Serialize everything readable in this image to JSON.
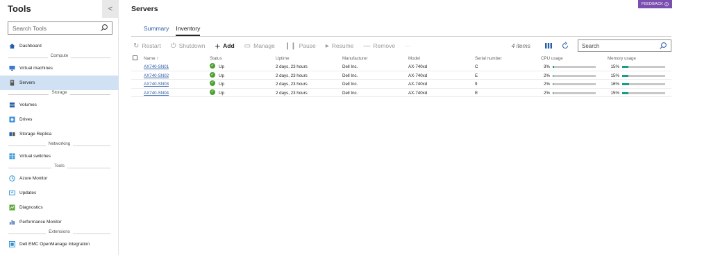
{
  "sidebar": {
    "title": "Tools",
    "collapse_glyph": "<",
    "search_placeholder": "Search Tools",
    "groups": {
      "compute": "Compute",
      "storage": "Storage",
      "networking": "Networking",
      "tools": "Tools",
      "extensions": "Extensions"
    },
    "items": {
      "dashboard": "Dashboard",
      "virtual_machines": "Virtual machines",
      "servers": "Servers",
      "volumes": "Volumes",
      "drives": "Drives",
      "storage_replica": "Storage Replica",
      "virtual_switches": "Virtual switches",
      "azure_monitor": "Azure Monitor",
      "updates": "Updates",
      "diagnostics": "Diagnostics",
      "performance_monitor": "Performance Monitor",
      "dell_emc": "Dell EMC OpenManage Integration"
    },
    "active_item": "Servers"
  },
  "header": {
    "title": "Servers",
    "feedback_label": "FEEDBACK",
    "feedback_icon": "info-icon"
  },
  "tabs": [
    {
      "label": "Summary",
      "active": false
    },
    {
      "label": "Inventory",
      "active": true
    }
  ],
  "toolbar": {
    "restart": "Restart",
    "shutdown": "Shutdown",
    "add": "Add",
    "manage": "Manage",
    "pause": "Pause",
    "resume": "Resume",
    "remove": "Remove",
    "more": "···",
    "items_count": "4 items",
    "search_placeholder": "Search"
  },
  "table": {
    "columns": {
      "name": "Name ↑",
      "status": "Status",
      "uptime": "Uptime",
      "manufacturer": "Manufacturer",
      "model": "Model",
      "serial": "Serial number",
      "cpu": "CPU usage",
      "memory": "Memory usage"
    },
    "rows": [
      {
        "name": "AX740-SN01",
        "status": "Up",
        "uptime": "2 days, 23 hours",
        "manufacturer": "Dell Inc.",
        "model": "AX-740xd",
        "serial": "C",
        "cpu": "3%",
        "cpu_fraction": 0.03,
        "memory": "15%",
        "memory_fraction": 0.15
      },
      {
        "name": "AX740-SN02",
        "status": "Up",
        "uptime": "2 days, 23 hours",
        "manufacturer": "Dell Inc.",
        "model": "AX-740xd",
        "serial": "E",
        "cpu": "2%",
        "cpu_fraction": 0.02,
        "memory": "15%",
        "memory_fraction": 0.15
      },
      {
        "name": "AX740-SN03",
        "status": "Up",
        "uptime": "2 days, 23 hours",
        "manufacturer": "Dell Inc.",
        "model": "AX-740xd",
        "serial": "9",
        "cpu": "2%",
        "cpu_fraction": 0.02,
        "memory": "16%",
        "memory_fraction": 0.16
      },
      {
        "name": "AX740-SN04",
        "status": "Up",
        "uptime": "2 days, 23 hours",
        "manufacturer": "Dell Inc.",
        "model": "AX-740xd",
        "serial": "E",
        "cpu": "2%",
        "cpu_fraction": 0.02,
        "memory": "15%",
        "memory_fraction": 0.15
      }
    ]
  },
  "colors": {
    "accent": "#2b5aa5",
    "active_nav": "#cfe1f3",
    "feedback": "#7b4fb0",
    "status_up": "#4aa02c",
    "usage_fill": "#1b9b8b"
  }
}
